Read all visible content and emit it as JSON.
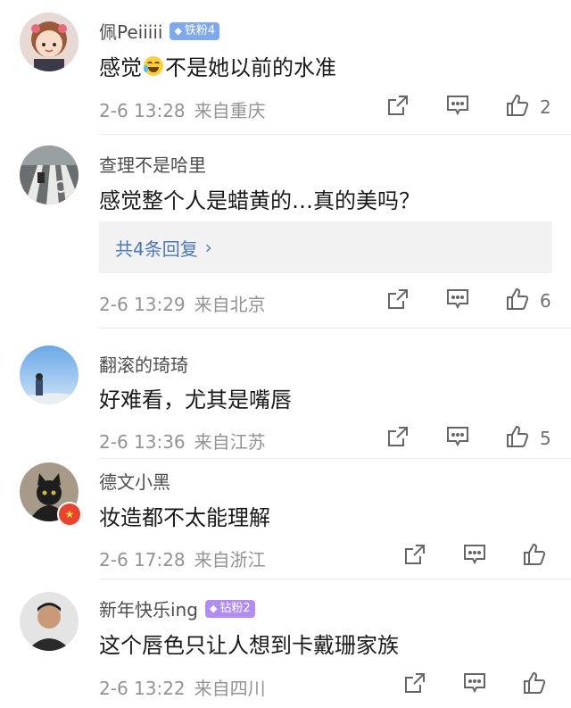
{
  "comments": [
    {
      "username": "佩Peiiiii",
      "badge": "铁粉4",
      "text_before": "感觉",
      "text_emoji": "laughing-crying-emoji",
      "text_after": "不是她以前的水准",
      "time": "2-6 13:28",
      "location": "来自重庆",
      "likes": "2"
    },
    {
      "username": "查理不是哈里",
      "text": "感觉整个人是蜡黄的…真的美吗？",
      "replies_label": "共4条回复",
      "time": "2-6 13:29",
      "location": "来自北京",
      "likes": "6"
    },
    {
      "username": "翻滚的琦琦",
      "text": "好难看，尤其是嘴唇",
      "time": "2-6 13:36",
      "location": "来自江苏",
      "likes": "5"
    },
    {
      "username": "德文小黑",
      "text": "妆造都不太能理解",
      "time": "2-6 17:28",
      "location": "来自浙江",
      "likes": ""
    },
    {
      "username": "新年快乐ing",
      "badge": "钻粉2",
      "text": "这个唇色只让人想到卡戴珊家族",
      "time": "2-6 13:22",
      "location": "来自四川",
      "likes": ""
    }
  ],
  "colors": {
    "fan_badge_blue": "#7ea9ef",
    "fan_badge_purple": "#b38cf2",
    "link_blue": "#4c78b3",
    "meta_gray": "#939393"
  }
}
